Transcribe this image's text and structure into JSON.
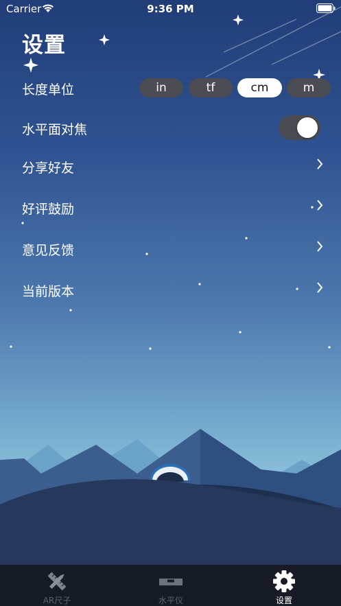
{
  "status_bar": {
    "carrier": "Carrier",
    "time": "9:36 PM"
  },
  "page_title": "设置",
  "settings": {
    "length_unit": {
      "label": "长度单位",
      "options": [
        "in",
        "tf",
        "cm",
        "m"
      ],
      "selected": "cm"
    },
    "horizontal_focus": {
      "label": "水平面对焦",
      "enabled": true
    },
    "items": [
      {
        "label": "分享好友"
      },
      {
        "label": "好评鼓励"
      },
      {
        "label": "意见反馈"
      },
      {
        "label": "当前版本"
      }
    ]
  },
  "tabbar": {
    "tabs": [
      {
        "label": "AR尺子",
        "icon": "ruler-pencil-icon"
      },
      {
        "label": "水平仪",
        "icon": "spirit-level-icon"
      },
      {
        "label": "设置",
        "icon": "gear-icon"
      }
    ],
    "active": "设置"
  },
  "colors": {
    "segment_bg": "#4b4c54",
    "tabbar_bg": "#161b26",
    "sky_top": "#213d78"
  }
}
